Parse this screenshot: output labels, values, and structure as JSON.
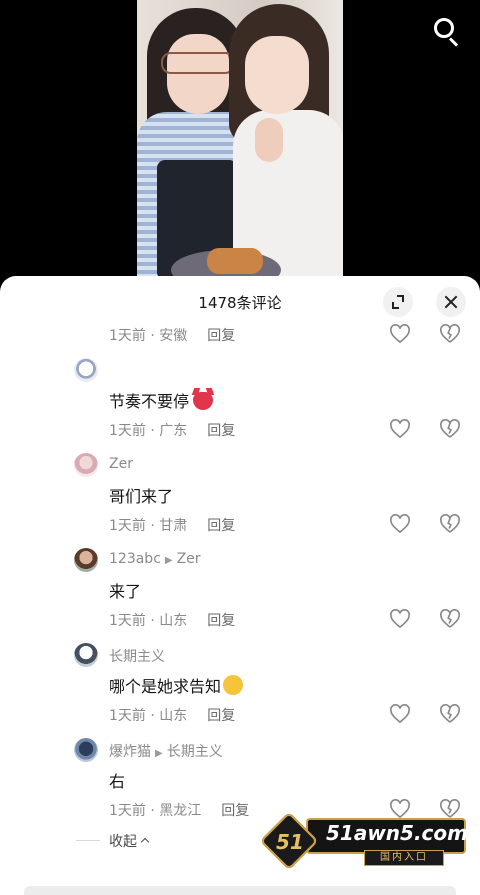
{
  "header": {
    "comment_count_title": "1478条评论"
  },
  "comments": [
    {
      "id": "c0",
      "username": "",
      "reply_to": "",
      "text": "",
      "meta": "1天前 · 安徽",
      "reply_label": "回复"
    },
    {
      "id": "c1",
      "username": "",
      "reply_to": "",
      "text": "节奏不要停",
      "meta": "1天前 · 广东",
      "reply_label": "回复",
      "emoji": "devil-emoji"
    },
    {
      "id": "c2",
      "username": "Zer",
      "reply_to": "",
      "text": "哥们来了",
      "meta": "1天前 · 甘肃",
      "reply_label": "回复"
    },
    {
      "id": "c3",
      "username": "123abc",
      "reply_to": "Zer",
      "text": "来了",
      "meta": "1天前 · 山东",
      "reply_label": "回复"
    },
    {
      "id": "c4",
      "username": "长期主义",
      "reply_to": "",
      "text": "哪个是她求告知",
      "meta": "1天前 · 山东",
      "reply_label": "回复",
      "emoji": "thinking-emoji"
    },
    {
      "id": "c5",
      "username": "爆炸猫",
      "reply_to": "长期主义",
      "text": "右",
      "meta": "1天前 · 黑龙江",
      "reply_label": "回复"
    }
  ],
  "collapse_label": "收起",
  "watermark": {
    "site": "51awn5.com",
    "tag": "国内入口",
    "logo_text": "51"
  },
  "icons": {
    "search": "search-icon",
    "expand": "expand-icon",
    "close": "close-icon",
    "like": "heart-icon",
    "dislike": "broken-heart-icon"
  },
  "colors": {
    "sheet_bg": "#ffffff",
    "meta_text": "#8a8a8a",
    "primary_text": "#161616",
    "watermark_gold": "#c9a14a"
  }
}
